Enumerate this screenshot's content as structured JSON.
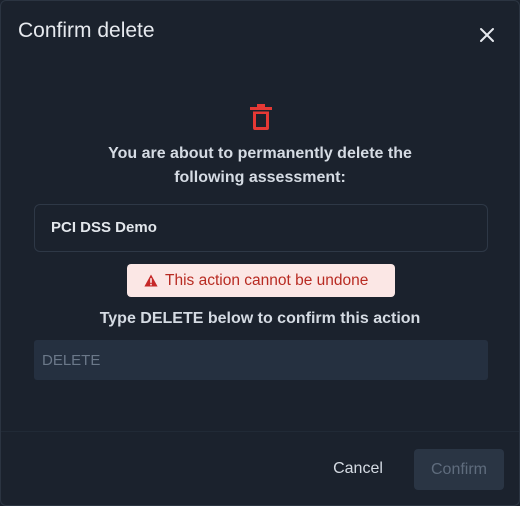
{
  "dialog": {
    "title": "Confirm delete",
    "close_icon": "close-icon",
    "trash_icon": "trash-icon",
    "message_line1": "You are about to permanently delete the",
    "message_line2": "following assessment:",
    "assessment_name": "PCI DSS Demo",
    "warning_icon": "warning-triangle-icon",
    "warning_text": "This action cannot be undone",
    "instruction": "Type DELETE below to confirm this action",
    "confirm_input": {
      "value": "",
      "placeholder": "DELETE"
    },
    "cancel_label": "Cancel",
    "confirm_label": "Confirm",
    "confirm_enabled": false
  },
  "colors": {
    "background": "#1b222d",
    "danger": "#e53935",
    "warning_bg": "#fbe7e5",
    "warning_text": "#b82b22"
  }
}
